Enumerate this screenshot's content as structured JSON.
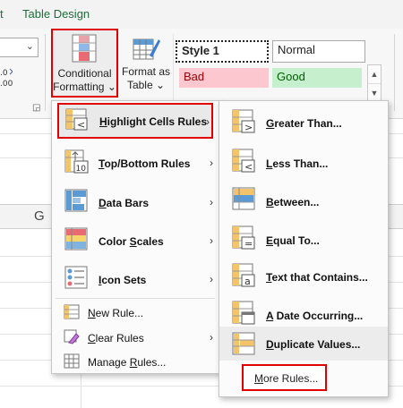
{
  "ribbon": {
    "tabs": [
      "t",
      "Table Design"
    ],
    "number_format_fragment": ".0\n.00",
    "conditional_formatting": {
      "line1": "Conditional",
      "line2": "Formatting",
      "arrow": "⌄"
    },
    "format_as_table": {
      "line1": "Format as",
      "line2": "Table",
      "arrow": "⌄"
    },
    "cell_styles": {
      "style1": "Style 1",
      "normal": "Normal",
      "bad": "Bad",
      "good": "Good"
    },
    "colors": {
      "bad_bg": "#fcc7ce",
      "bad_fg": "#9c0006",
      "good_bg": "#c6efce",
      "good_fg": "#006100",
      "accent_red": "#e00000",
      "tab_green": "#1e6e3a"
    }
  },
  "sheet": {
    "column_header": "G"
  },
  "menu_main": {
    "items": [
      {
        "label_pre": "",
        "label_u": "H",
        "label_post": "ighlight Cells Rules",
        "icon": "highlight-cells-icon",
        "has_submenu": true,
        "selected": true
      },
      {
        "label_pre": "",
        "label_u": "T",
        "label_post": "op/Bottom Rules",
        "icon": "top-bottom-icon",
        "has_submenu": true
      },
      {
        "label_pre": "",
        "label_u": "D",
        "label_post": "ata Bars",
        "icon": "data-bars-icon",
        "has_submenu": true
      },
      {
        "label_pre": "Color ",
        "label_u": "S",
        "label_post": "cales",
        "icon": "color-scales-icon",
        "has_submenu": true
      },
      {
        "label_pre": "",
        "label_u": "I",
        "label_post": "con Sets",
        "icon": "icon-sets-icon",
        "has_submenu": true
      },
      {
        "label_pre": "",
        "label_u": "N",
        "label_post": "ew Rule...",
        "icon": "new-rule-icon",
        "has_submenu": false
      },
      {
        "label_pre": "",
        "label_u": "C",
        "label_post": "lear Rules",
        "icon": "clear-rules-icon",
        "has_submenu": true
      },
      {
        "label_pre": "Manage ",
        "label_u": "R",
        "label_post": "ules...",
        "icon": "manage-rules-icon",
        "has_submenu": false
      }
    ]
  },
  "menu_sub": {
    "items": [
      {
        "label_pre": "",
        "label_u": "G",
        "label_post": "reater Than...",
        "icon": "greater-than-icon"
      },
      {
        "label_pre": "",
        "label_u": "L",
        "label_post": "ess Than...",
        "icon": "less-than-icon"
      },
      {
        "label_pre": "",
        "label_u": "B",
        "label_post": "etween...",
        "icon": "between-icon"
      },
      {
        "label_pre": "",
        "label_u": "E",
        "label_post": "qual To...",
        "icon": "equal-to-icon"
      },
      {
        "label_pre": "",
        "label_u": "T",
        "label_post": "ext that Contains...",
        "icon": "text-contains-icon"
      },
      {
        "label_pre": "",
        "label_u": "A",
        "label_post": " Date Occurring...",
        "icon": "date-occurring-icon"
      },
      {
        "label_pre": "",
        "label_u": "D",
        "label_post": "uplicate Values...",
        "icon": "duplicate-values-icon"
      }
    ],
    "more_rules": {
      "label_pre": "",
      "label_u": "M",
      "label_post": "ore Rules..."
    }
  }
}
